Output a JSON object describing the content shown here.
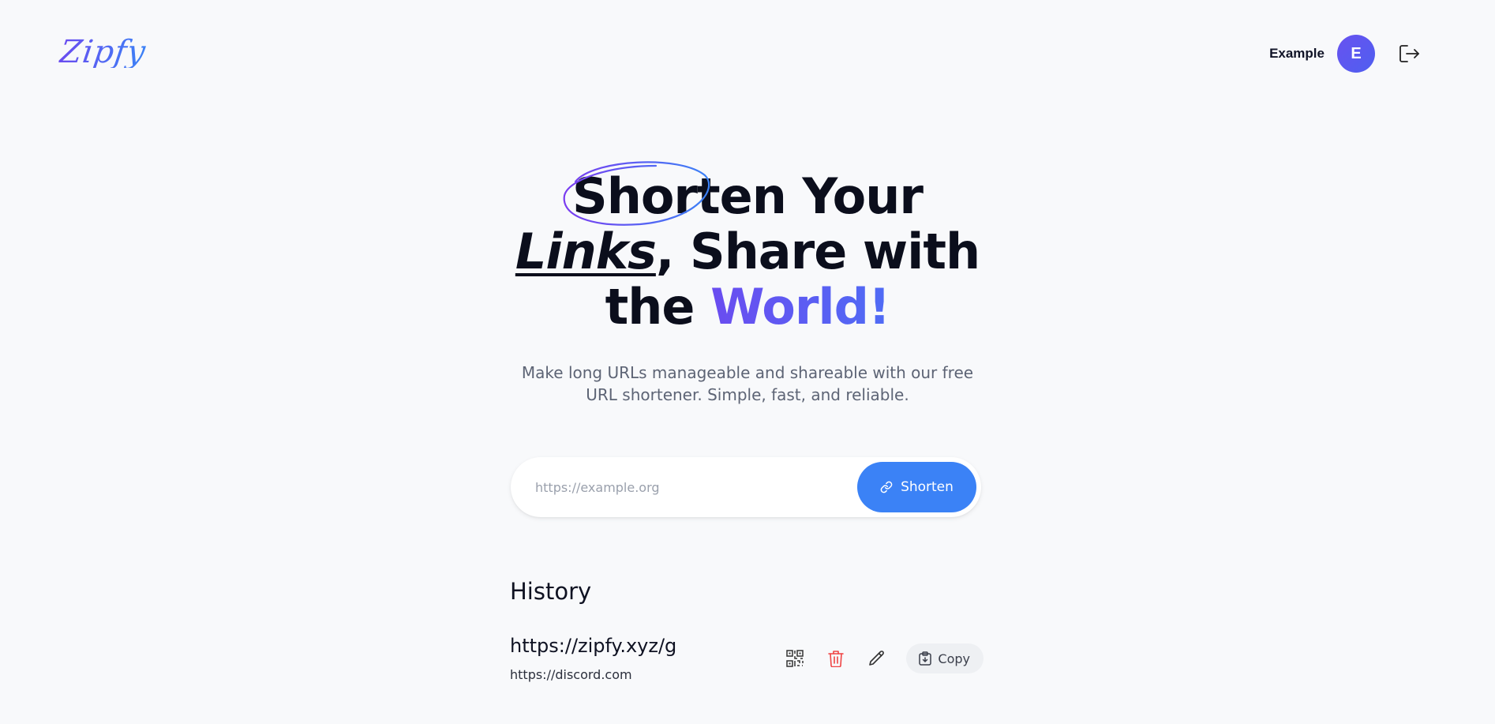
{
  "header": {
    "logo_text": "Zipfy",
    "user_name": "Example",
    "avatar_initial": "E"
  },
  "hero": {
    "title_line1_circled": "Shorten",
    "title_line1_rest": " Your",
    "title_line2_links": "Links",
    "title_line2_rest": ", Share with",
    "title_line3_the": "the ",
    "title_line3_world": "World!",
    "subtitle": "Make long URLs manageable and shareable with our free URL shortener. Simple, fast, and reliable."
  },
  "form": {
    "input_value": "",
    "input_placeholder": "https://example.org",
    "button_label": "Shorten"
  },
  "history": {
    "title": "History",
    "items": [
      {
        "short_url": "https://zipfy.xyz/g",
        "long_url": "https://discord.com",
        "copy_label": "Copy"
      }
    ]
  },
  "colors": {
    "accent_blue": "#3b82f6",
    "accent_purple": "#6a4cf0",
    "background": "#f8f9fb",
    "delete_red": "#ef4444"
  },
  "icons": [
    "logout-icon",
    "link-icon",
    "qr-code-icon",
    "trash-icon",
    "pencil-icon",
    "clipboard-icon"
  ]
}
